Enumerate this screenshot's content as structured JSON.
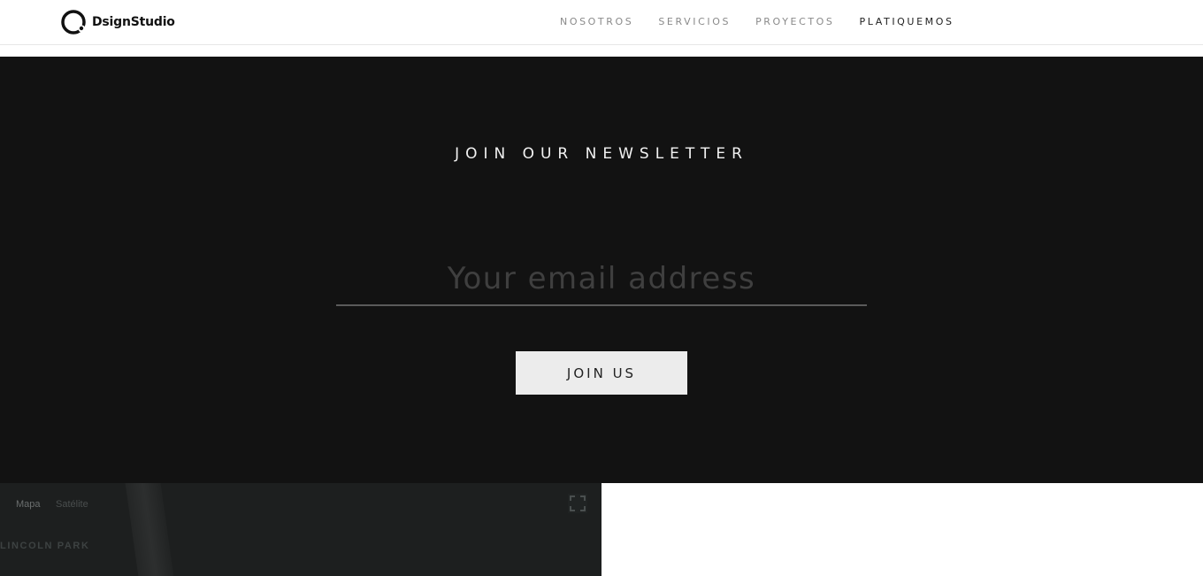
{
  "header": {
    "logo_text": "DsignStudio",
    "nav": [
      {
        "label": "NOSOTROS"
      },
      {
        "label": "SERVICIOS"
      },
      {
        "label": "PROYECTOS"
      },
      {
        "label": "PLATIQUEMOS"
      }
    ]
  },
  "newsletter": {
    "title": "JOIN OUR NEWSLETTER",
    "email_placeholder": "Your email address",
    "email_value": "",
    "button_label": "JOIN US"
  },
  "map": {
    "tab_map": "Mapa",
    "tab_satellite": "Satélite",
    "area_label": "LINCOLN PARK"
  },
  "colors": {
    "newsletter_bg": "#121212",
    "button_bg": "#ececec",
    "nav_active": "#222222",
    "nav_inactive": "#8a8a8a"
  },
  "icons": {
    "logo": "ring-logo-icon",
    "fullscreen": "fullscreen-icon"
  }
}
